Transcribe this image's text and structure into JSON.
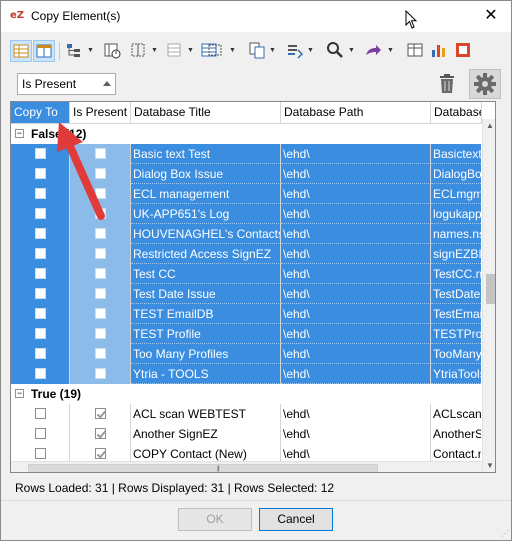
{
  "window": {
    "title": "Copy Element(s)",
    "app_icon": "eZ",
    "close_glyph": "✕"
  },
  "toolbar": {
    "icons": [
      "grid-view-icon",
      "split-view-icon",
      "tree-icon",
      "column-delete-icon",
      "column-select-icon",
      "column-group-icon",
      "table-icon",
      "selection-icon",
      "copy-icon",
      "merge-icon",
      "search-icon",
      "export-icon",
      "chart-icon",
      "office-icon"
    ]
  },
  "filter": {
    "selected": "Is Present"
  },
  "grid": {
    "columns": [
      "Copy To",
      "Is Present",
      "Database Title",
      "Database Path",
      "Database"
    ],
    "groups": [
      {
        "label": "False (12)",
        "expander": "−",
        "rows": [
          {
            "copy_to": false,
            "is_present": false,
            "title": "Basic text Test",
            "path": "\\ehd\\",
            "db": "Basictext"
          },
          {
            "copy_to": false,
            "is_present": false,
            "title": "Dialog Box Issue",
            "path": "\\ehd\\",
            "db": "DialogBo"
          },
          {
            "copy_to": false,
            "is_present": false,
            "title": "ECL management",
            "path": "\\ehd\\",
            "db": "ECLmgm"
          },
          {
            "copy_to": false,
            "is_present": false,
            "title": "UK-APP651's Log",
            "path": "\\ehd\\",
            "db": "logukapp"
          },
          {
            "copy_to": false,
            "is_present": false,
            "title": "HOUVENAGHEL's Contacts",
            "path": "\\ehd\\",
            "db": "names.ns"
          },
          {
            "copy_to": false,
            "is_present": false,
            "title": "Restricted Access SignEZ",
            "path": "\\ehd\\",
            "db": "signEZBIS"
          },
          {
            "copy_to": false,
            "is_present": false,
            "title": "Test CC",
            "path": "\\ehd\\",
            "db": "TestCC.ns"
          },
          {
            "copy_to": false,
            "is_present": false,
            "title": "Test Date Issue",
            "path": "\\ehd\\",
            "db": "TestDateI"
          },
          {
            "copy_to": false,
            "is_present": false,
            "title": "TEST EmailDB",
            "path": "\\ehd\\",
            "db": "TestEmail"
          },
          {
            "copy_to": false,
            "is_present": false,
            "title": "TEST Profile",
            "path": "\\ehd\\",
            "db": "TESTProfi"
          },
          {
            "copy_to": false,
            "is_present": false,
            "title": "Too Many Profiles",
            "path": "\\ehd\\",
            "db": "TooMany"
          },
          {
            "copy_to": false,
            "is_present": false,
            "title": "Ytria - TOOLS",
            "path": "\\ehd\\",
            "db": "YtriaTools"
          }
        ]
      },
      {
        "label": "True (19)",
        "expander": "−",
        "rows": [
          {
            "copy_to": false,
            "is_present": true,
            "title": "ACL scan WEBTEST",
            "path": "\\ehd\\",
            "db": "ACLscan."
          },
          {
            "copy_to": false,
            "is_present": true,
            "title": "Another SignEZ",
            "path": "\\ehd\\",
            "db": "AnotherS"
          },
          {
            "copy_to": false,
            "is_present": true,
            "title": "COPY Contact (New)",
            "path": "\\ehd\\",
            "db": "Contact.n"
          }
        ]
      }
    ]
  },
  "status": {
    "text": "Rows Loaded: 31  |  Rows Displayed: 31  |  Rows Selected: 12"
  },
  "buttons": {
    "ok": "OK",
    "cancel": "Cancel"
  },
  "colors": {
    "selection": "#3b8de0",
    "arrow": "#e03a3a"
  }
}
